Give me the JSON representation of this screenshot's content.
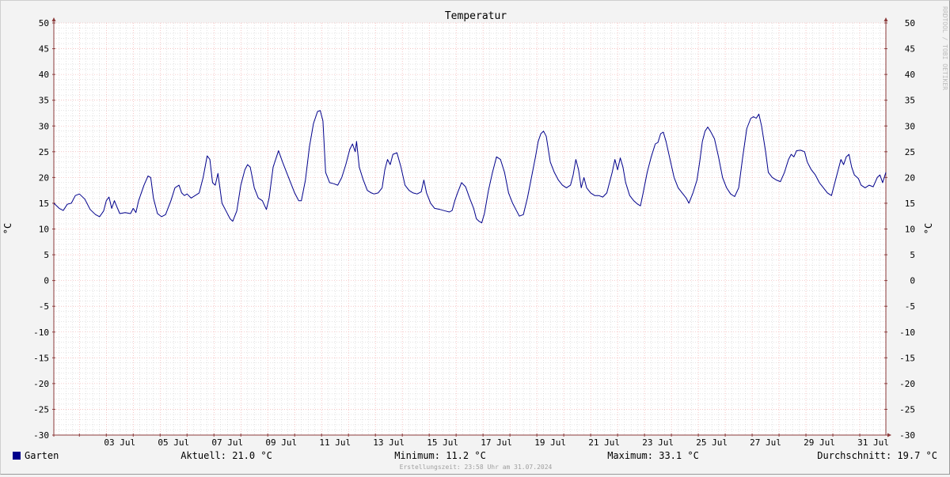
{
  "chart_data": {
    "type": "line",
    "title": "Temperatur",
    "ylabel": "°C",
    "ylabel_right": "°C",
    "watermark": "RRDTOOL / TOBI OETIKER",
    "ylim": [
      -30,
      50
    ],
    "yticks": [
      50,
      45,
      40,
      35,
      30,
      25,
      20,
      15,
      10,
      5,
      0,
      -5,
      -10,
      -15,
      -20,
      -25,
      -30
    ],
    "xlim": [
      1.05,
      31.97
    ],
    "xticks": [
      {
        "day": 3,
        "label": "03 Jul"
      },
      {
        "day": 5,
        "label": "05 Jul"
      },
      {
        "day": 7,
        "label": "07 Jul"
      },
      {
        "day": 9,
        "label": "09 Jul"
      },
      {
        "day": 11,
        "label": "11 Jul"
      },
      {
        "day": 13,
        "label": "13 Jul"
      },
      {
        "day": 15,
        "label": "15 Jul"
      },
      {
        "day": 17,
        "label": "17 Jul"
      },
      {
        "day": 19,
        "label": "19 Jul"
      },
      {
        "day": 21,
        "label": "21 Jul"
      },
      {
        "day": 23,
        "label": "23 Jul"
      },
      {
        "day": 25,
        "label": "25 Jul"
      },
      {
        "day": 27,
        "label": "27 Jul"
      },
      {
        "day": 29,
        "label": "29 Jul"
      },
      {
        "day": 31,
        "label": "31 Jul"
      }
    ],
    "grid": true,
    "series": [
      {
        "name": "Garten",
        "color": "#00008b",
        "points": [
          [
            1.05,
            15.0
          ],
          [
            1.25,
            14.0
          ],
          [
            1.4,
            13.6
          ],
          [
            1.55,
            14.8
          ],
          [
            1.7,
            15.0
          ],
          [
            1.85,
            16.5
          ],
          [
            2.0,
            16.8
          ],
          [
            2.2,
            15.8
          ],
          [
            2.4,
            13.8
          ],
          [
            2.6,
            12.8
          ],
          [
            2.75,
            12.4
          ],
          [
            2.9,
            13.5
          ],
          [
            3.0,
            15.5
          ],
          [
            3.1,
            16.2
          ],
          [
            3.2,
            14.0
          ],
          [
            3.3,
            15.5
          ],
          [
            3.4,
            14.2
          ],
          [
            3.5,
            13.0
          ],
          [
            3.7,
            13.2
          ],
          [
            3.9,
            13.0
          ],
          [
            4.0,
            14.0
          ],
          [
            4.1,
            13.2
          ],
          [
            4.2,
            15.5
          ],
          [
            4.4,
            18.5
          ],
          [
            4.55,
            20.3
          ],
          [
            4.65,
            20.0
          ],
          [
            4.75,
            16.0
          ],
          [
            4.9,
            13.0
          ],
          [
            5.05,
            12.4
          ],
          [
            5.2,
            12.8
          ],
          [
            5.4,
            15.5
          ],
          [
            5.55,
            18.0
          ],
          [
            5.7,
            18.5
          ],
          [
            5.8,
            17.0
          ],
          [
            5.9,
            16.5
          ],
          [
            6.0,
            16.8
          ],
          [
            6.15,
            16.0
          ],
          [
            6.3,
            16.5
          ],
          [
            6.45,
            17.0
          ],
          [
            6.6,
            20.0
          ],
          [
            6.75,
            24.2
          ],
          [
            6.85,
            23.5
          ],
          [
            6.95,
            19.0
          ],
          [
            7.05,
            18.5
          ],
          [
            7.15,
            20.8
          ],
          [
            7.3,
            15.0
          ],
          [
            7.45,
            13.5
          ],
          [
            7.6,
            12.0
          ],
          [
            7.7,
            11.5
          ],
          [
            7.85,
            13.5
          ],
          [
            8.0,
            18.5
          ],
          [
            8.15,
            21.5
          ],
          [
            8.25,
            22.5
          ],
          [
            8.35,
            22.0
          ],
          [
            8.5,
            18.0
          ],
          [
            8.65,
            16.0
          ],
          [
            8.8,
            15.5
          ],
          [
            8.95,
            13.8
          ],
          [
            9.05,
            16.0
          ],
          [
            9.2,
            22.0
          ],
          [
            9.4,
            25.2
          ],
          [
            9.55,
            23.0
          ],
          [
            9.7,
            21.0
          ],
          [
            9.85,
            19.0
          ],
          [
            10.0,
            17.0
          ],
          [
            10.15,
            15.5
          ],
          [
            10.25,
            15.5
          ],
          [
            10.4,
            19.5
          ],
          [
            10.55,
            26.0
          ],
          [
            10.7,
            30.5
          ],
          [
            10.85,
            32.8
          ],
          [
            10.95,
            33.0
          ],
          [
            11.05,
            31.0
          ],
          [
            11.15,
            21.0
          ],
          [
            11.3,
            19.0
          ],
          [
            11.45,
            18.8
          ],
          [
            11.6,
            18.5
          ],
          [
            11.75,
            20.0
          ],
          [
            11.9,
            22.5
          ],
          [
            12.05,
            25.5
          ],
          [
            12.15,
            26.5
          ],
          [
            12.25,
            25.0
          ],
          [
            12.3,
            27.0
          ],
          [
            12.4,
            22.0
          ],
          [
            12.55,
            19.5
          ],
          [
            12.7,
            17.5
          ],
          [
            12.85,
            17.0
          ],
          [
            12.95,
            16.8
          ],
          [
            13.1,
            17.0
          ],
          [
            13.25,
            18.0
          ],
          [
            13.35,
            21.5
          ],
          [
            13.45,
            23.5
          ],
          [
            13.55,
            22.5
          ],
          [
            13.65,
            24.5
          ],
          [
            13.8,
            24.8
          ],
          [
            13.95,
            22.0
          ],
          [
            14.1,
            18.5
          ],
          [
            14.25,
            17.5
          ],
          [
            14.4,
            17.0
          ],
          [
            14.55,
            16.8
          ],
          [
            14.7,
            17.2
          ],
          [
            14.8,
            19.5
          ],
          [
            14.9,
            17.0
          ],
          [
            15.05,
            15.0
          ],
          [
            15.2,
            14.0
          ],
          [
            15.4,
            13.8
          ],
          [
            15.6,
            13.5
          ],
          [
            15.75,
            13.3
          ],
          [
            15.85,
            13.6
          ],
          [
            15.95,
            15.5
          ],
          [
            16.05,
            17.0
          ],
          [
            16.2,
            19.0
          ],
          [
            16.35,
            18.2
          ],
          [
            16.5,
            16.0
          ],
          [
            16.65,
            14.0
          ],
          [
            16.75,
            12.0
          ],
          [
            16.85,
            11.5
          ],
          [
            16.95,
            11.2
          ],
          [
            17.05,
            13.0
          ],
          [
            17.2,
            17.5
          ],
          [
            17.35,
            21.0
          ],
          [
            17.5,
            24.0
          ],
          [
            17.65,
            23.5
          ],
          [
            17.8,
            21.0
          ],
          [
            17.95,
            17.0
          ],
          [
            18.1,
            15.0
          ],
          [
            18.25,
            13.5
          ],
          [
            18.35,
            12.5
          ],
          [
            18.5,
            12.8
          ],
          [
            18.65,
            16.0
          ],
          [
            18.8,
            20.0
          ],
          [
            18.95,
            24.0
          ],
          [
            19.05,
            27.0
          ],
          [
            19.15,
            28.5
          ],
          [
            19.25,
            29.0
          ],
          [
            19.35,
            28.0
          ],
          [
            19.5,
            23.0
          ],
          [
            19.65,
            21.0
          ],
          [
            19.8,
            19.5
          ],
          [
            19.95,
            18.5
          ],
          [
            20.1,
            18.0
          ],
          [
            20.25,
            18.5
          ],
          [
            20.35,
            20.5
          ],
          [
            20.45,
            23.5
          ],
          [
            20.55,
            21.5
          ],
          [
            20.65,
            18.0
          ],
          [
            20.75,
            20.0
          ],
          [
            20.85,
            18.0
          ],
          [
            21.0,
            17.0
          ],
          [
            21.15,
            16.5
          ],
          [
            21.3,
            16.5
          ],
          [
            21.45,
            16.2
          ],
          [
            21.6,
            17.0
          ],
          [
            21.7,
            19.0
          ],
          [
            21.8,
            21.0
          ],
          [
            21.9,
            23.5
          ],
          [
            22.0,
            21.5
          ],
          [
            22.1,
            23.8
          ],
          [
            22.2,
            22.0
          ],
          [
            22.3,
            19.0
          ],
          [
            22.45,
            16.5
          ],
          [
            22.6,
            15.5
          ],
          [
            22.75,
            14.8
          ],
          [
            22.85,
            14.5
          ],
          [
            22.95,
            17.0
          ],
          [
            23.1,
            21.0
          ],
          [
            23.25,
            24.0
          ],
          [
            23.4,
            26.5
          ],
          [
            23.5,
            26.8
          ],
          [
            23.6,
            28.5
          ],
          [
            23.7,
            28.8
          ],
          [
            23.8,
            27.0
          ],
          [
            23.95,
            23.5
          ],
          [
            24.1,
            20.0
          ],
          [
            24.25,
            18.0
          ],
          [
            24.4,
            17.0
          ],
          [
            24.55,
            16.0
          ],
          [
            24.65,
            15.0
          ],
          [
            24.8,
            17.0
          ],
          [
            24.95,
            19.5
          ],
          [
            25.05,
            23.0
          ],
          [
            25.15,
            27.0
          ],
          [
            25.25,
            29.0
          ],
          [
            25.35,
            29.8
          ],
          [
            25.45,
            29.0
          ],
          [
            25.6,
            27.5
          ],
          [
            25.75,
            24.0
          ],
          [
            25.9,
            20.0
          ],
          [
            26.05,
            18.0
          ],
          [
            26.2,
            16.8
          ],
          [
            26.35,
            16.3
          ],
          [
            26.5,
            18.0
          ],
          [
            26.65,
            24.0
          ],
          [
            26.8,
            29.5
          ],
          [
            26.95,
            31.5
          ],
          [
            27.05,
            31.8
          ],
          [
            27.15,
            31.5
          ],
          [
            27.25,
            32.3
          ],
          [
            27.35,
            30.0
          ],
          [
            27.5,
            25.0
          ],
          [
            27.6,
            21.0
          ],
          [
            27.75,
            20.0
          ],
          [
            27.9,
            19.5
          ],
          [
            28.05,
            19.2
          ],
          [
            28.2,
            21.0
          ],
          [
            28.35,
            23.5
          ],
          [
            28.45,
            24.5
          ],
          [
            28.55,
            24.0
          ],
          [
            28.65,
            25.2
          ],
          [
            28.8,
            25.3
          ],
          [
            28.95,
            25.0
          ],
          [
            29.05,
            23.0
          ],
          [
            29.2,
            21.5
          ],
          [
            29.35,
            20.5
          ],
          [
            29.5,
            19.0
          ],
          [
            29.65,
            18.0
          ],
          [
            29.8,
            17.0
          ],
          [
            29.95,
            16.5
          ],
          [
            30.05,
            18.5
          ],
          [
            30.2,
            21.5
          ],
          [
            30.3,
            23.5
          ],
          [
            30.4,
            22.5
          ],
          [
            30.5,
            24.0
          ],
          [
            30.6,
            24.5
          ],
          [
            30.7,
            22.0
          ],
          [
            30.8,
            20.5
          ],
          [
            30.95,
            19.8
          ],
          [
            31.05,
            18.5
          ],
          [
            31.2,
            18.0
          ],
          [
            31.35,
            18.5
          ],
          [
            31.5,
            18.2
          ],
          [
            31.65,
            20.0
          ],
          [
            31.75,
            20.5
          ],
          [
            31.85,
            19.0
          ],
          [
            31.97,
            21.0
          ]
        ]
      }
    ],
    "legend": {
      "series_name": "Garten",
      "swatch_color": "#00008b",
      "current": "Aktuell: 21.0 °C",
      "minimum": "Minimum: 11.2 °C",
      "maximum": "Maximum: 33.1 °C",
      "average": "Durchschnitt: 19.7 °C"
    },
    "footer": "Erstellungszeit: 23:58 Uhr am 31.07.2024",
    "colors": {
      "background": "#f3f3f3",
      "canvas": "#ffffff",
      "major_grid": "#f0a0a0",
      "minor_grid": "#c8c8c8",
      "axis": "#8b3a3a",
      "line": "#00008b",
      "text": "#000000"
    }
  }
}
